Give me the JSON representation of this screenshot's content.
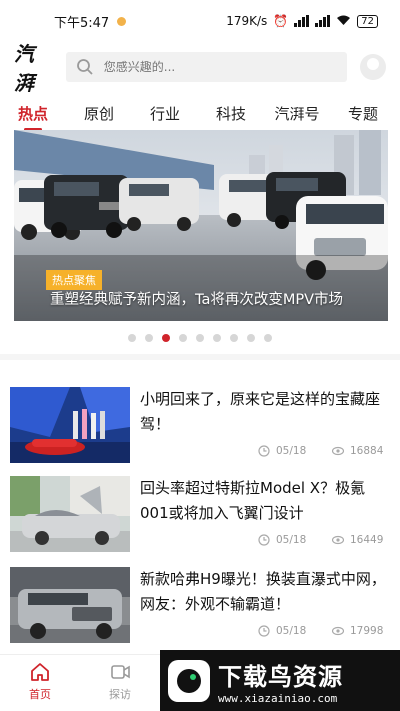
{
  "status": {
    "time": "下午5:47",
    "net_speed": "179K/s",
    "battery": "72"
  },
  "header": {
    "logo": "汽湃",
    "search_placeholder": "您感兴趣的..."
  },
  "tabs": [
    {
      "label": "热点",
      "active": true
    },
    {
      "label": "原创"
    },
    {
      "label": "行业"
    },
    {
      "label": "科技"
    },
    {
      "label": "汽湃号"
    },
    {
      "label": "专题"
    }
  ],
  "banner": {
    "tag": "热点聚焦",
    "title": "重塑经典赋予新内涵，Ta将再次改变MPV市场",
    "dot_count": 9,
    "active_dot": 3
  },
  "news": [
    {
      "title": "小明回来了，原来它是这样的宝藏座驾！",
      "date": "05/18",
      "views": "16884"
    },
    {
      "title": "回头率超过特斯拉Model X？极氪001或将加入飞翼门设计",
      "date": "05/18",
      "views": "16449"
    },
    {
      "title": "新款哈弗H9曝光！换装直瀑式中网，网友：外观不输霸道！",
      "date": "05/18",
      "views": "17998"
    }
  ],
  "bottom_nav": [
    {
      "label": "首页",
      "active": true
    },
    {
      "label": "探访"
    }
  ],
  "watermark": {
    "title": "下载鸟资源",
    "url": "www.xiazainiao.com"
  },
  "colors": {
    "accent": "#d0242b",
    "tag": "#f6b12a"
  }
}
